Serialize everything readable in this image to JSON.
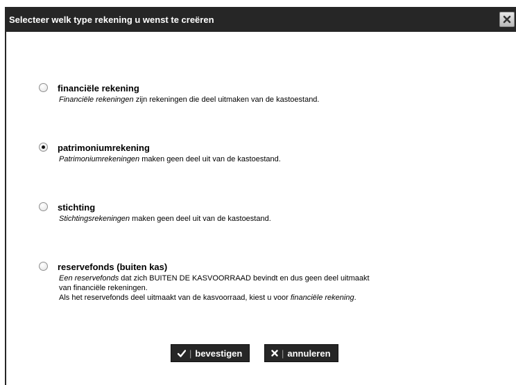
{
  "dialog": {
    "title": "Selecteer welk type rekening u wenst te creëren",
    "close_icon": "close-icon"
  },
  "options": [
    {
      "label": "financiële rekening",
      "checked": false,
      "desc_em": "Financiële rekeningen",
      "desc_rest": " zijn rekeningen die deel uitmaken van de kastoestand."
    },
    {
      "label": "patrimoniumrekening",
      "checked": true,
      "desc_em": "Patrimoniumrekeningen",
      "desc_rest": " maken geen deel uit van de kastoestand."
    },
    {
      "label": "stichting",
      "checked": false,
      "desc_em": "Stichtingsrekeningen",
      "desc_rest": " maken geen deel uit van de kastoestand."
    },
    {
      "label": "reservefonds (buiten kas)",
      "checked": false,
      "desc_em": "Een reservefonds",
      "desc_rest": " dat zich BUITEN DE KASVOORRAAD bevindt en dus geen deel uitmaakt",
      "desc_line2": "van financiële rekeningen.",
      "desc_line3_pre": "Als het reservefonds deel uitmaakt van de kasvoorraad, kiest u voor ",
      "desc_line3_em": "financiële rekening",
      "desc_line3_post": "."
    }
  ],
  "buttons": {
    "confirm_label": "bevestigen",
    "cancel_label": "annuleren",
    "confirm_icon": "checkmark-icon",
    "cancel_icon": "x-icon",
    "separator": "|"
  }
}
